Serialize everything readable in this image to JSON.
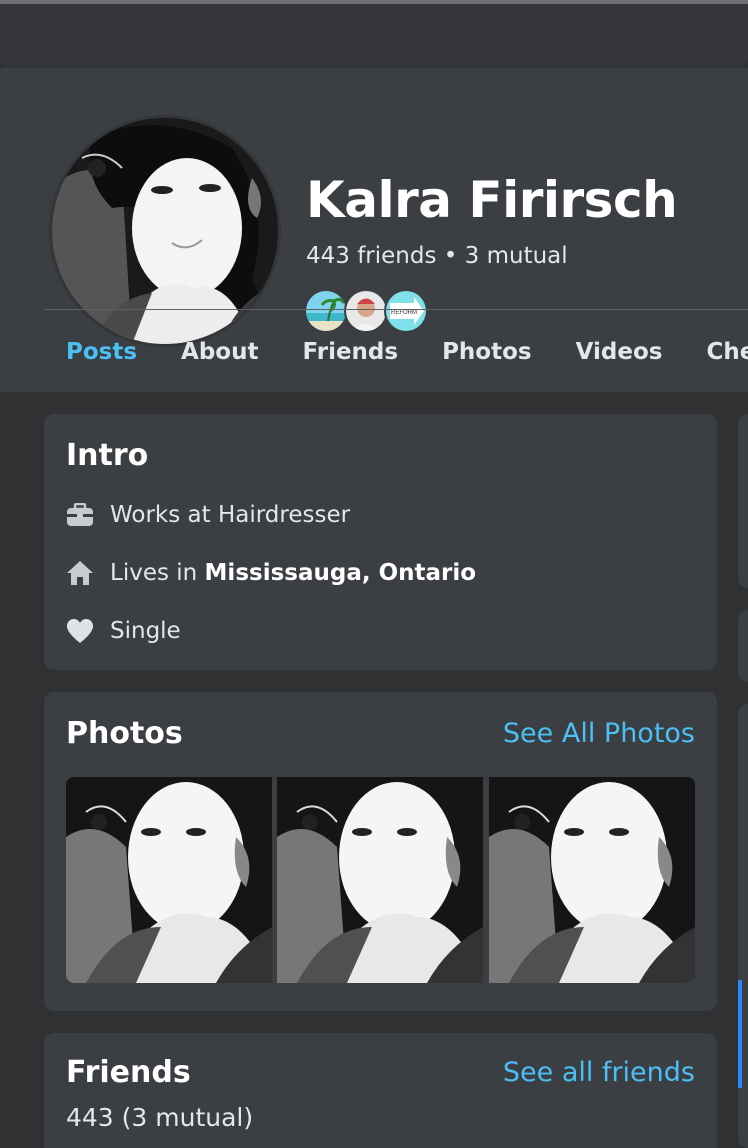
{
  "profile": {
    "name": "Kalra Firirsch",
    "friends_summary": "443 friends • 3 mutual",
    "mutual_friends": [
      {
        "icon": "beach-avatar"
      },
      {
        "icon": "person-avatar"
      },
      {
        "icon": "reform-avatar",
        "label": "REFORM"
      }
    ]
  },
  "tabs": [
    {
      "label": "Posts",
      "active": true
    },
    {
      "label": "About"
    },
    {
      "label": "Friends"
    },
    {
      "label": "Photos"
    },
    {
      "label": "Videos"
    },
    {
      "label": "Check-ins"
    }
  ],
  "intro": {
    "title": "Intro",
    "work": {
      "icon": "briefcase-icon",
      "text": "Works at Hairdresser"
    },
    "home": {
      "icon": "home-icon",
      "prefix": "Lives in ",
      "place": "Mississauga, Ontario"
    },
    "relationship": {
      "icon": "heart-icon",
      "text": "Single"
    }
  },
  "photos": {
    "title": "Photos",
    "see_all": "See All Photos"
  },
  "friends": {
    "title": "Friends",
    "see_all": "See all friends",
    "count_text": "443 (3 mutual)"
  },
  "colors": {
    "background": "#2f3133",
    "card": "#3b3e42",
    "accent": "#4bc0f4",
    "tab_underline": "#2d88ff"
  }
}
